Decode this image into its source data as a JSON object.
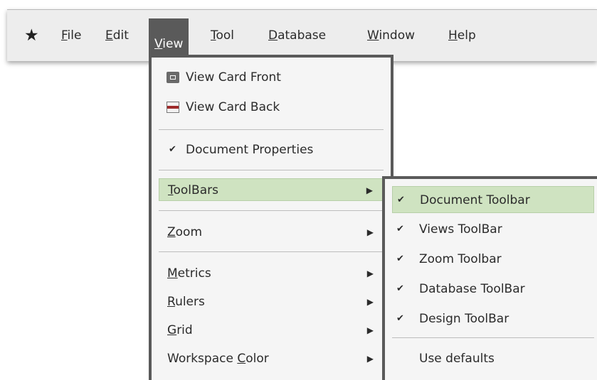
{
  "menubar": {
    "items": [
      {
        "mnemonic": "F",
        "rest": "ile"
      },
      {
        "mnemonic": "E",
        "rest": "dit"
      },
      {
        "mnemonic": "V",
        "rest": "iew"
      },
      {
        "mnemonic": "T",
        "rest": "ool"
      },
      {
        "mnemonic": "D",
        "rest": "atabase"
      },
      {
        "mnemonic": "W",
        "rest": "indow"
      },
      {
        "mnemonic": "H",
        "rest": "elp"
      }
    ],
    "app_icon": "star-icon"
  },
  "view_menu": {
    "view_card_front": "View Card Front",
    "view_card_back": "View Card Back",
    "document_properties": "Document Properties",
    "toolbars": {
      "mnemonic": "T",
      "rest": "oolBars"
    },
    "zoom": {
      "mnemonic": "Z",
      "rest": "oom"
    },
    "metrics": {
      "mnemonic": "M",
      "rest": "etrics"
    },
    "rulers": {
      "mnemonic": "R",
      "rest": "ulers"
    },
    "grid": {
      "mnemonic": "G",
      "rest": "rid"
    },
    "workspace_color": {
      "pre": "Workspace ",
      "mnemonic": "C",
      "rest": "olor"
    }
  },
  "toolbars_submenu": {
    "items": [
      {
        "label": "Document Toolbar",
        "checked": true
      },
      {
        "label": "Views ToolBar",
        "checked": true
      },
      {
        "label": "Zoom Toolbar",
        "checked": true
      },
      {
        "label": "Database ToolBar",
        "checked": true
      },
      {
        "label": "Design ToolBar",
        "checked": true
      }
    ],
    "use_defaults": "Use defaults"
  },
  "colors": {
    "highlight": "#cfe3c1",
    "menu_border": "#5a5a5a",
    "active_menu": "#5a5a5a"
  }
}
